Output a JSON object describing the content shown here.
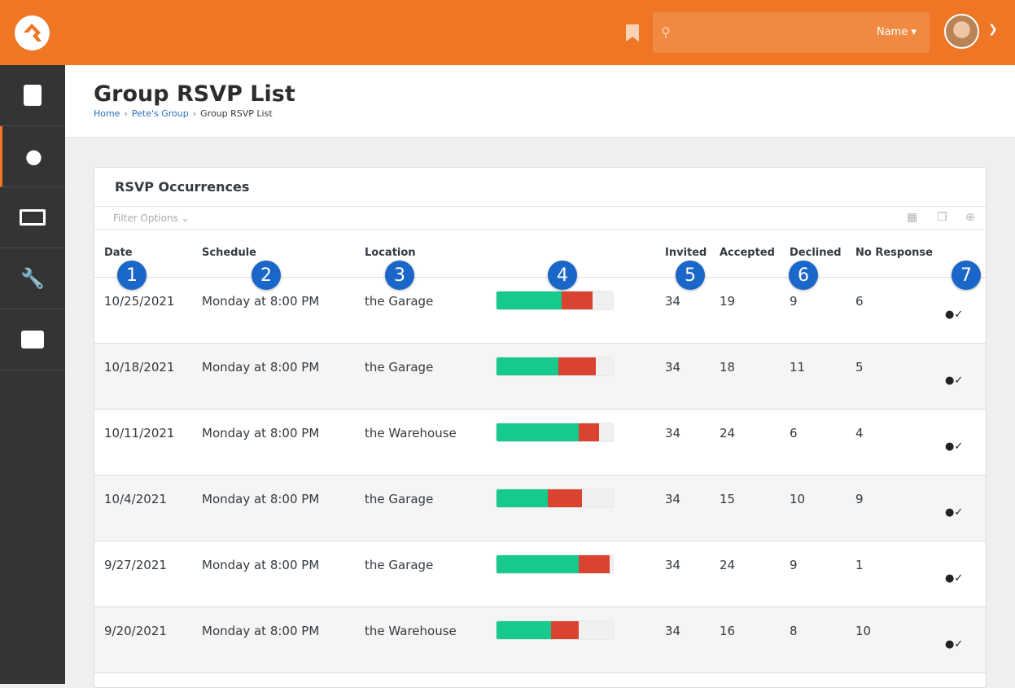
{
  "header": {
    "search_filter": "Name",
    "search_icon": "search-icon",
    "bookmark_icon": "bookmark-icon"
  },
  "sidebar": {
    "items": [
      {
        "icon": "book-icon"
      },
      {
        "icon": "user-icon",
        "active": true
      },
      {
        "icon": "money-icon"
      },
      {
        "icon": "wrench-icon"
      },
      {
        "icon": "briefcase-icon"
      }
    ]
  },
  "page": {
    "title": "Group RSVP List",
    "breadcrumb": [
      "Home",
      "Pete's Group",
      "Group RSVP List"
    ]
  },
  "panel": {
    "title": "RSVP Occurrences",
    "filter_label": "Filter Options"
  },
  "colors": {
    "accent": "#ee7625",
    "accepted": "#16c98d",
    "declined": "#d9432f",
    "badge": "#1a66c9"
  },
  "table": {
    "headers": [
      "Date",
      "Schedule",
      "Location",
      "",
      "Invited",
      "Accepted",
      "Declined",
      "No Response"
    ],
    "rows": [
      {
        "date": "10/25/2021",
        "schedule": "Monday at 8:00 PM",
        "location": "the Garage",
        "invited": "34",
        "accepted": "19",
        "declined": "9",
        "no_response": "6"
      },
      {
        "date": "10/18/2021",
        "schedule": "Monday at 8:00 PM",
        "location": "the Garage",
        "invited": "34",
        "accepted": "18",
        "declined": "11",
        "no_response": "5"
      },
      {
        "date": "10/11/2021",
        "schedule": "Monday at 8:00 PM",
        "location": "the Warehouse",
        "invited": "34",
        "accepted": "24",
        "declined": "6",
        "no_response": "4"
      },
      {
        "date": "10/4/2021",
        "schedule": "Monday at 8:00 PM",
        "location": "the Garage",
        "invited": "34",
        "accepted": "15",
        "declined": "10",
        "no_response": "9"
      },
      {
        "date": "9/27/2021",
        "schedule": "Monday at 8:00 PM",
        "location": "the Garage",
        "invited": "34",
        "accepted": "24",
        "declined": "9",
        "no_response": "1"
      },
      {
        "date": "9/20/2021",
        "schedule": "Monday at 8:00 PM",
        "location": "the Warehouse",
        "invited": "34",
        "accepted": "16",
        "declined": "8",
        "no_response": "10"
      }
    ]
  },
  "callouts": [
    "1",
    "2",
    "3",
    "4",
    "5",
    "6",
    "7"
  ]
}
